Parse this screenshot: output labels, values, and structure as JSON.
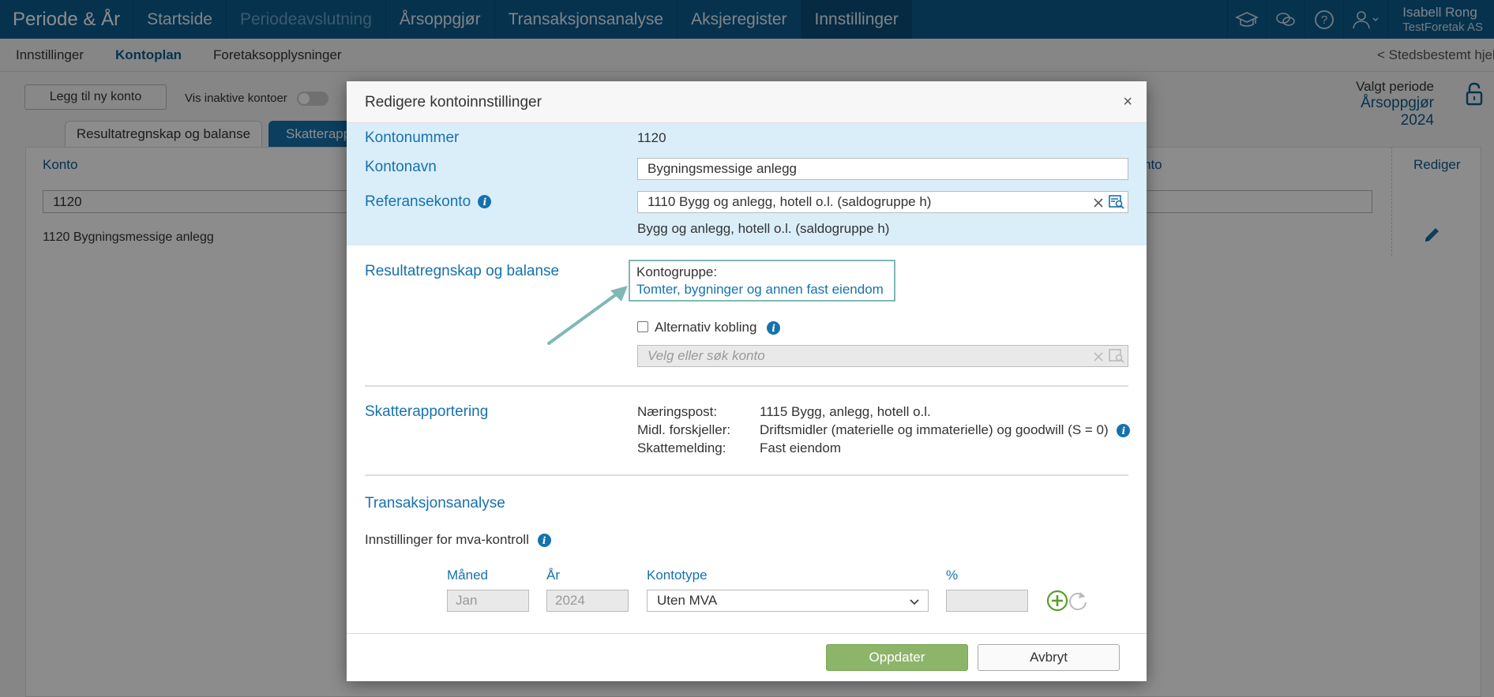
{
  "app": {
    "brand": "Periode & År",
    "nav": [
      {
        "label": "Startside",
        "state": "normal"
      },
      {
        "label": "Periodeavslutning",
        "state": "disabled"
      },
      {
        "label": "Årsoppgjør",
        "state": "normal"
      },
      {
        "label": "Transaksjonsanalyse",
        "state": "normal"
      },
      {
        "label": "Aksjeregister",
        "state": "normal"
      },
      {
        "label": "Innstillinger",
        "state": "active"
      }
    ],
    "icons": [
      "graduation-cap-icon",
      "chat-icon",
      "help-icon",
      "user-icon"
    ],
    "user": {
      "name": "Isabell Rong",
      "company": "TestForetak AS"
    }
  },
  "subnav": {
    "items": [
      {
        "label": "Innstillinger",
        "active": false
      },
      {
        "label": "Kontoplan",
        "active": true
      },
      {
        "label": "Foretaksopplysninger",
        "active": false
      }
    ],
    "right_link": "< Stedsbestemt hjelp"
  },
  "page": {
    "add_button": "Legg til ny konto",
    "inactive_label": "Vis inaktive kontoer",
    "inactive_on": false,
    "period_label": "Valgt periode",
    "period_value": "Årsoppgjør 2024",
    "tabs": [
      "Resultatregnskap og balanse",
      "Skatterapportering"
    ],
    "col_konto": "Konto",
    "col_to": "nto",
    "col_rediger": "Rediger",
    "filter_value": "1120",
    "row": "1120 Bygningsmessige anlegg"
  },
  "modal": {
    "title": "Redigere kontoinnstillinger",
    "close": "×",
    "kontonummer_label": "Kontonummer",
    "kontonummer_value": "1120",
    "kontonavn_label": "Kontonavn",
    "kontonavn_value": "Bygningsmessige anlegg",
    "referanse_label": "Referansekonto",
    "referanse_value": "1110 Bygg og anlegg, hotell o.l. (saldogruppe h)",
    "referanse_desc": "Bygg og anlegg, hotell o.l. (saldogruppe h)",
    "rb_label": "Resultatregnskap og balanse",
    "kontogruppe_label": "Kontogruppe:",
    "kontogruppe_value": "Tomter, bygninger og annen fast eiendom",
    "alt_kobling_label": "Alternativ kobling",
    "alt_kobling_checked": false,
    "alt_kobling_placeholder": "Velg eller søk konto",
    "skatt_label": "Skatterapportering",
    "skatt_rows": [
      {
        "key": "Næringspost:",
        "value": "1115 Bygg, anlegg, hotell o.l."
      },
      {
        "key": "Midl. forskjeller:",
        "value": "Driftsmidler (materielle og immaterielle) og goodwill (S = 0)"
      },
      {
        "key": "Skattemelding:",
        "value": "Fast eiendom"
      }
    ],
    "trans_label": "Transaksjonsanalyse",
    "mva_label": "Innstillinger for mva-kontroll",
    "mva": {
      "col_month": "Måned",
      "col_year": "År",
      "col_type": "Kontotype",
      "col_pct": "%",
      "month": "Jan",
      "year": "2024",
      "type": "Uten MVA",
      "pct": ""
    },
    "btn_update": "Oppdater",
    "btn_cancel": "Avbryt"
  },
  "colors": {
    "nav_bg": "#0c5c8f",
    "accent": "#1672ad",
    "band": "#daeefa",
    "primary_btn": "#8db56a",
    "callout": "#7fb8b6"
  }
}
